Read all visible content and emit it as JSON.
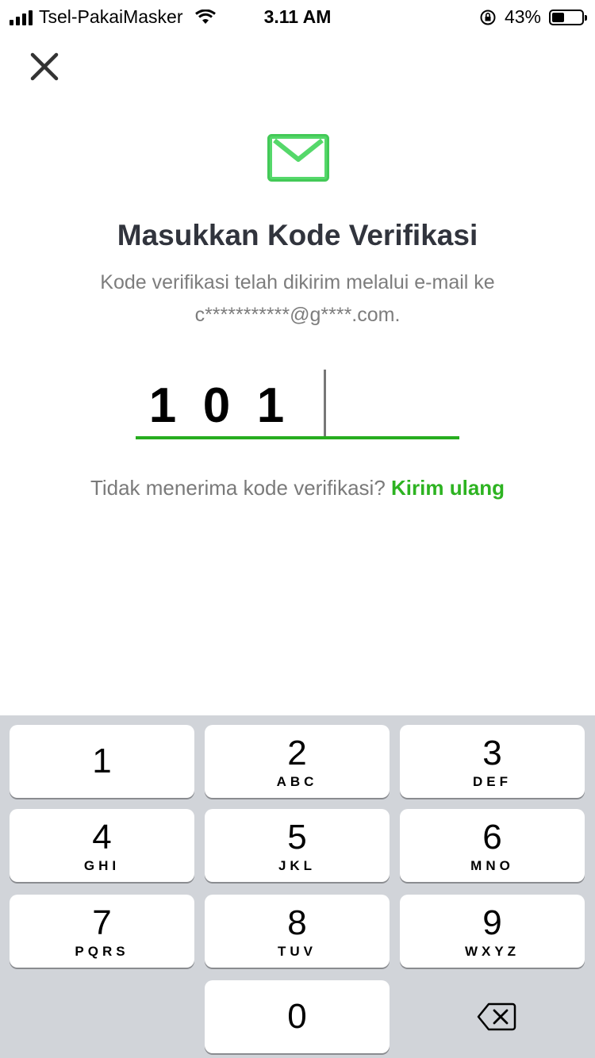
{
  "status_bar": {
    "carrier": "Tsel-PakaiMasker",
    "time": "3.11 AM",
    "battery_percent": "43%",
    "battery_level": 0.43
  },
  "header": {
    "close_icon": "close-icon"
  },
  "main": {
    "icon": "mail-icon",
    "title": "Masukkan Kode Verifikasi",
    "subtitle_line1": "Kode verifikasi telah dikirim melalui e-mail ke",
    "subtitle_line2": "c***********@g****.com.",
    "code_digits": [
      "1",
      "0",
      "1"
    ],
    "resend_prompt": "Tidak menerima kode verifikasi?",
    "resend_link": "Kirim ulang",
    "accent_color": "#2db321"
  },
  "keypad": {
    "keys": [
      {
        "num": "1",
        "letters": ""
      },
      {
        "num": "2",
        "letters": "ABC"
      },
      {
        "num": "3",
        "letters": "DEF"
      },
      {
        "num": "4",
        "letters": "GHI"
      },
      {
        "num": "5",
        "letters": "JKL"
      },
      {
        "num": "6",
        "letters": "MNO"
      },
      {
        "num": "7",
        "letters": "PQRS"
      },
      {
        "num": "8",
        "letters": "TUV"
      },
      {
        "num": "9",
        "letters": "WXYZ"
      },
      {
        "num": "0",
        "letters": ""
      }
    ],
    "delete_icon": "backspace-icon"
  }
}
